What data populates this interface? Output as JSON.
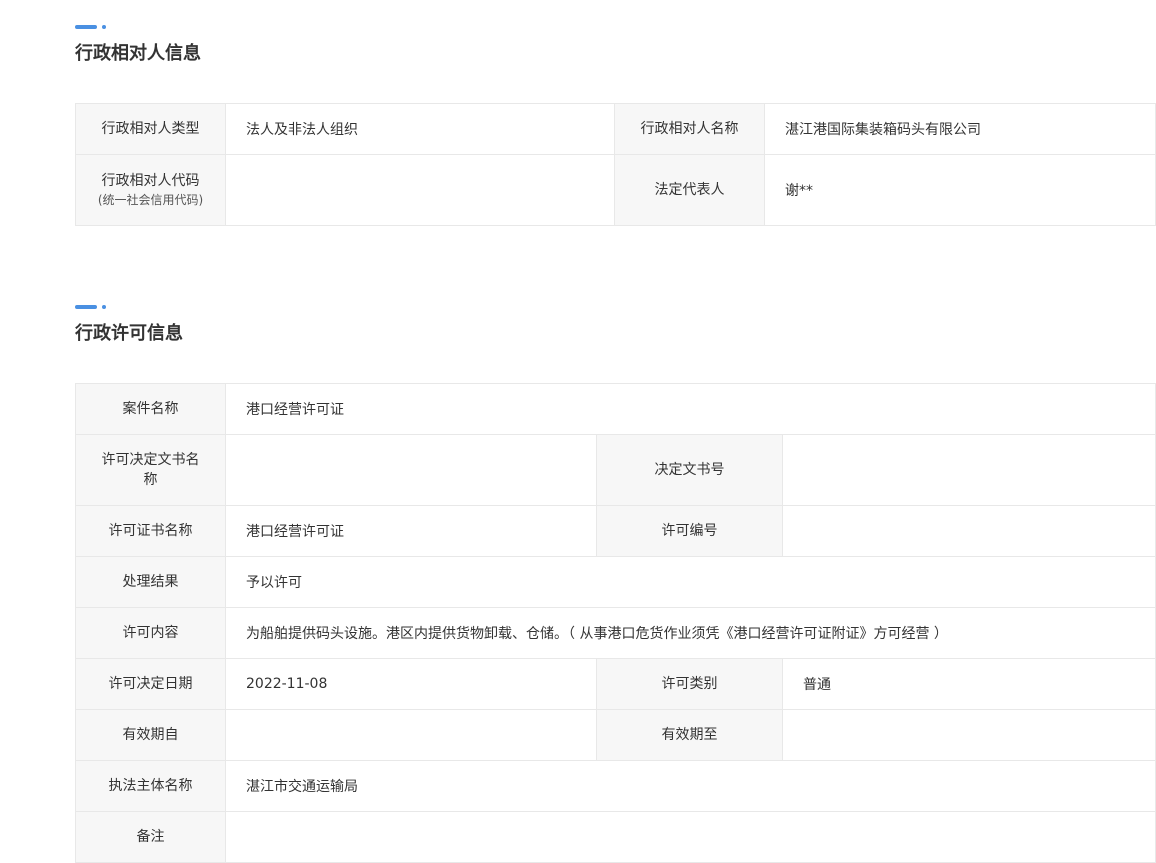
{
  "party_section": {
    "title": "行政相对人信息",
    "rows": [
      {
        "label1": "行政相对人类型",
        "value1": "法人及非法人组织",
        "label2": "行政相对人名称",
        "value2": "湛江港国际集装箱码头有限公司"
      },
      {
        "label1": "行政相对人代码",
        "label1_sub": "(统一社会信用代码)",
        "value1": "",
        "label2": "法定代表人",
        "value2": "谢**"
      }
    ]
  },
  "license_section": {
    "title": "行政许可信息",
    "case_name": {
      "label": "案件名称",
      "value": "港口经营许可证"
    },
    "decision_doc": {
      "label": "许可决定文书名称",
      "value": "",
      "label2": "决定文书号",
      "value2": ""
    },
    "certificate": {
      "label": "许可证书名称",
      "value": "港口经营许可证",
      "label2": "许可编号",
      "value2": ""
    },
    "result": {
      "label": "处理结果",
      "value": "予以许可"
    },
    "content": {
      "label": "许可内容",
      "value": "为船舶提供码头设施。港区内提供货物卸载、仓储。（ 从事港口危货作业须凭《港口经营许可证附证》方可经营 ）"
    },
    "decision_date": {
      "label": "许可决定日期",
      "value": "2022-11-08",
      "label2": "许可类别",
      "value2": "普通"
    },
    "validity": {
      "label": "有效期自",
      "value": "",
      "label2": "有效期至",
      "value2": ""
    },
    "authority": {
      "label": "执法主体名称",
      "value": "湛江市交通运输局"
    },
    "remarks": {
      "label": "备注",
      "value": ""
    }
  }
}
